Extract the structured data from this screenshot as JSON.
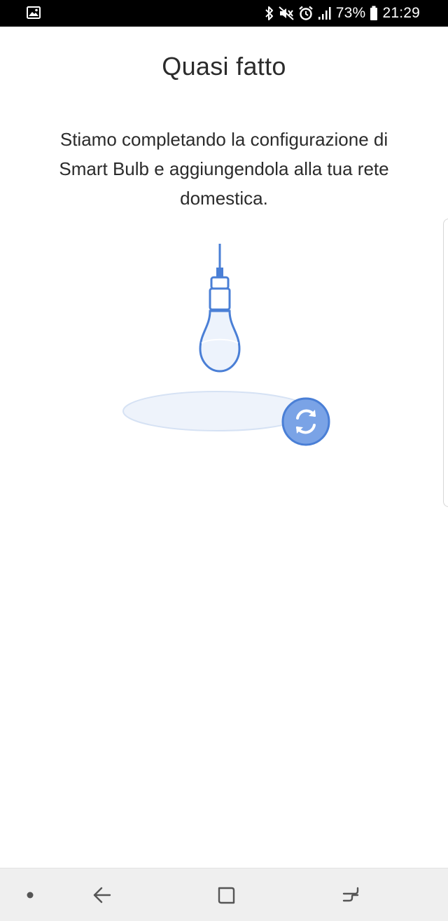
{
  "status_bar": {
    "battery_percent": "73%",
    "time": "21:29",
    "icons": [
      "gallery-icon",
      "bluetooth-icon",
      "mute-icon",
      "alarm-icon",
      "signal-icon",
      "battery-icon"
    ]
  },
  "screen": {
    "title": "Quasi fatto",
    "description": "Stiamo completando la configurazione di Smart Bulb e aggiungendola alla tua rete domestica."
  },
  "illustration": {
    "items": [
      "light-bulb-icon",
      "sync-icon"
    ],
    "colors": {
      "accent": "#4a7fd6",
      "bulb_fill": "#edf3fc",
      "sync_fill": "#7aa3e6",
      "platform_fill": "#eef3fb"
    }
  },
  "nav_bar": {
    "items": [
      "recent-dot-icon",
      "back-icon",
      "home-icon",
      "recents-icon"
    ]
  }
}
